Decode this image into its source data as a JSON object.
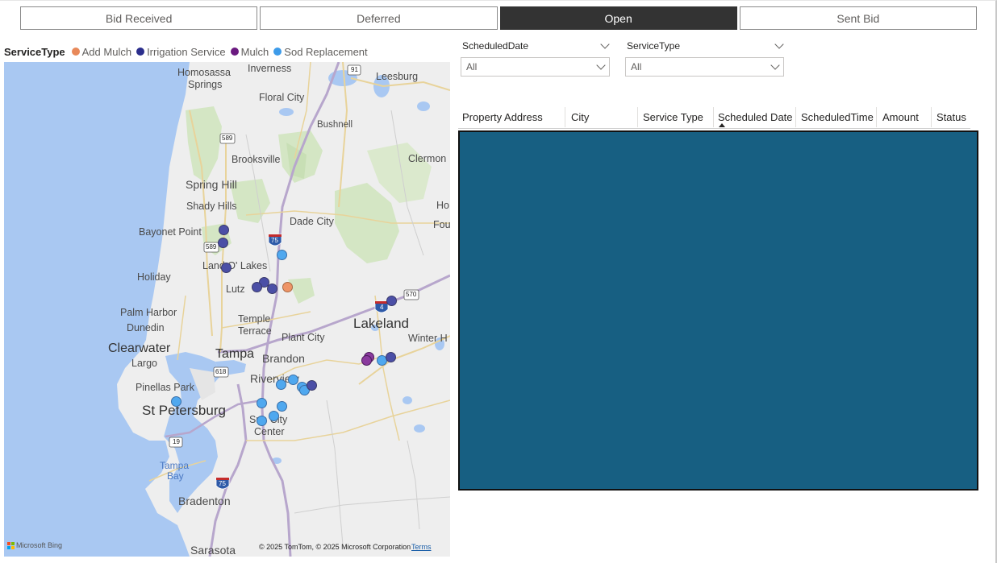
{
  "tabs": [
    {
      "label": "Bid Received",
      "active": false
    },
    {
      "label": "Deferred",
      "active": false
    },
    {
      "label": "Open",
      "active": true
    },
    {
      "label": "Sent Bid",
      "active": false
    }
  ],
  "legend": {
    "title": "ServiceType",
    "items": [
      {
        "label": "Add Mulch",
        "color": "#e8895a"
      },
      {
        "label": "Irrigation Service",
        "color": "#2b2e8c"
      },
      {
        "label": "Mulch",
        "color": "#6b1a80"
      },
      {
        "label": "Sod Replacement",
        "color": "#3d9be9"
      }
    ]
  },
  "map": {
    "labels": {
      "homosassa": "Homosassa",
      "springs": "Springs",
      "inverness": "Inverness",
      "leesburg": "Leesburg",
      "floral_city": "Floral City",
      "bushnell": "Bushnell",
      "brooksville": "Brooksville",
      "clermont": "Clermon",
      "spring_hill": "Spring Hill",
      "shady_hills": "Shady Hills",
      "dade_city": "Dade City",
      "ho": "Ho",
      "fou": "Fou",
      "bayonet_point": "Bayonet Point",
      "land_o_lakes": "Land O' Lakes",
      "holiday": "Holiday",
      "lutz": "Lutz",
      "palm_harbor": "Palm Harbor",
      "dunedin": "Dunedin",
      "temple": "Temple",
      "terrace": "Terrace",
      "plant_city": "Plant City",
      "lakeland": "Lakeland",
      "winter_h": "Winter H",
      "clearwater": "Clearwater",
      "tampa": "Tampa",
      "brandon": "Brandon",
      "largo": "Largo",
      "riverview": "Riverview",
      "pinellas_park": "Pinellas Park",
      "st_petersburg": "St Petersburg",
      "sun_city": "Sun City",
      "center": "Center",
      "tampa_bay_1": "Tampa",
      "tampa_bay_2": "Bay",
      "bradenton": "Bradenton",
      "sarasota": "Sarasota"
    },
    "shields": {
      "r91": "91",
      "r589a": "589",
      "r589b": "589",
      "i75a": "75",
      "i4": "4",
      "r570": "570",
      "r618": "618",
      "r19": "19",
      "i75b": "75"
    },
    "attribution": {
      "bing": "Microsoft Bing",
      "copyright": "© 2025 TomTom, © 2025 Microsoft Corporation",
      "terms": "Terms"
    }
  },
  "filters": {
    "scheduled_date": {
      "label": "ScheduledDate",
      "value": "All"
    },
    "service_type": {
      "label": "ServiceType",
      "value": "All"
    }
  },
  "table": {
    "columns": [
      "Property Address",
      "City",
      "Service Type",
      "Scheduled Date",
      "ScheduledTime",
      "Amount",
      "Status"
    ],
    "sorted_column": "Scheduled Date",
    "sort_direction": "ascending",
    "body_color": "#175f82"
  }
}
